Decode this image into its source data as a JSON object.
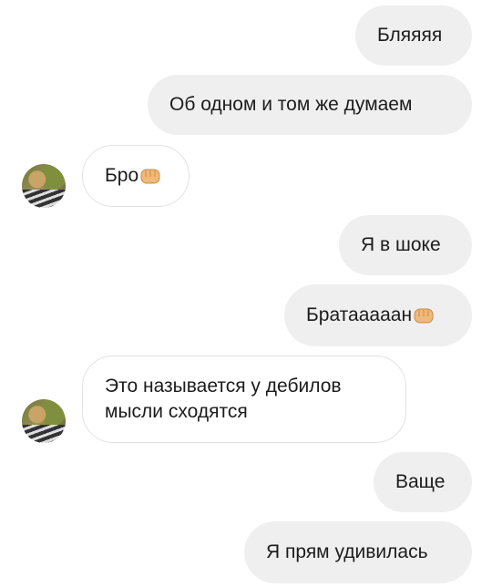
{
  "messages": [
    {
      "dir": "out",
      "text": "Бляяяя"
    },
    {
      "dir": "out",
      "text": "Об одном и том же думаем"
    },
    {
      "dir": "in",
      "text": "Бро",
      "emoji": "fist-emoji"
    },
    {
      "dir": "out",
      "text": "Я в шоке"
    },
    {
      "dir": "out",
      "text": "Братааааан",
      "emoji": "fist-emoji"
    },
    {
      "dir": "in",
      "line1": "Это называется у дебилов",
      "line2": "мысли сходятся"
    },
    {
      "dir": "out",
      "text": "Ваще"
    },
    {
      "dir": "out",
      "text": "Я прям удивилась"
    }
  ],
  "colors": {
    "outgoing_bubble": "#efefef",
    "incoming_border": "#e2e2e2"
  },
  "avatar_icon": "contact-avatar"
}
